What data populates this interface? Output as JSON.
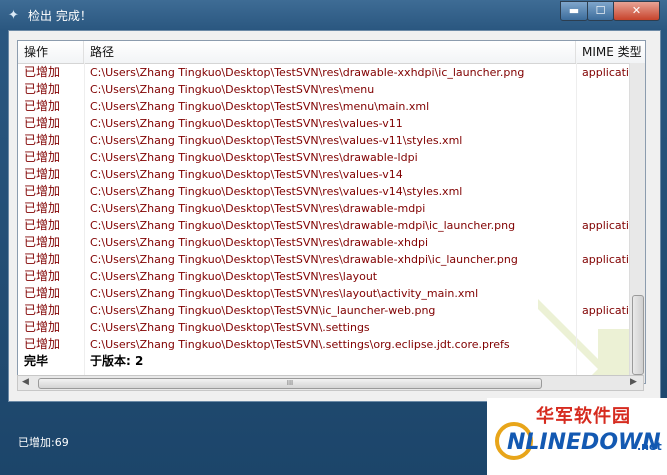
{
  "window": {
    "title": "检出 完成！",
    "minimize_glyph": "▬",
    "maximize_glyph": "☐",
    "close_glyph": "✕"
  },
  "table": {
    "columns": [
      "操作",
      "路径",
      "MIME 类型"
    ],
    "rows": [
      {
        "action": "已增加",
        "path": "C:\\Users\\Zhang Tingkuo\\Desktop\\TestSVN\\res\\drawable-xxhdpi\\ic_launcher.png",
        "mime": "application"
      },
      {
        "action": "已增加",
        "path": "C:\\Users\\Zhang Tingkuo\\Desktop\\TestSVN\\res\\menu",
        "mime": ""
      },
      {
        "action": "已增加",
        "path": "C:\\Users\\Zhang Tingkuo\\Desktop\\TestSVN\\res\\menu\\main.xml",
        "mime": ""
      },
      {
        "action": "已增加",
        "path": "C:\\Users\\Zhang Tingkuo\\Desktop\\TestSVN\\res\\values-v11",
        "mime": ""
      },
      {
        "action": "已增加",
        "path": "C:\\Users\\Zhang Tingkuo\\Desktop\\TestSVN\\res\\values-v11\\styles.xml",
        "mime": ""
      },
      {
        "action": "已增加",
        "path": "C:\\Users\\Zhang Tingkuo\\Desktop\\TestSVN\\res\\drawable-ldpi",
        "mime": ""
      },
      {
        "action": "已增加",
        "path": "C:\\Users\\Zhang Tingkuo\\Desktop\\TestSVN\\res\\values-v14",
        "mime": ""
      },
      {
        "action": "已增加",
        "path": "C:\\Users\\Zhang Tingkuo\\Desktop\\TestSVN\\res\\values-v14\\styles.xml",
        "mime": ""
      },
      {
        "action": "已增加",
        "path": "C:\\Users\\Zhang Tingkuo\\Desktop\\TestSVN\\res\\drawable-mdpi",
        "mime": ""
      },
      {
        "action": "已增加",
        "path": "C:\\Users\\Zhang Tingkuo\\Desktop\\TestSVN\\res\\drawable-mdpi\\ic_launcher.png",
        "mime": "application"
      },
      {
        "action": "已增加",
        "path": "C:\\Users\\Zhang Tingkuo\\Desktop\\TestSVN\\res\\drawable-xhdpi",
        "mime": ""
      },
      {
        "action": "已增加",
        "path": "C:\\Users\\Zhang Tingkuo\\Desktop\\TestSVN\\res\\drawable-xhdpi\\ic_launcher.png",
        "mime": "application"
      },
      {
        "action": "已增加",
        "path": "C:\\Users\\Zhang Tingkuo\\Desktop\\TestSVN\\res\\layout",
        "mime": ""
      },
      {
        "action": "已增加",
        "path": "C:\\Users\\Zhang Tingkuo\\Desktop\\TestSVN\\res\\layout\\activity_main.xml",
        "mime": ""
      },
      {
        "action": "已增加",
        "path": "C:\\Users\\Zhang Tingkuo\\Desktop\\TestSVN\\ic_launcher-web.png",
        "mime": "application"
      },
      {
        "action": "已增加",
        "path": "C:\\Users\\Zhang Tingkuo\\Desktop\\TestSVN\\.settings",
        "mime": ""
      },
      {
        "action": "已增加",
        "path": "C:\\Users\\Zhang Tingkuo\\Desktop\\TestSVN\\.settings\\org.eclipse.jdt.core.prefs",
        "mime": ""
      },
      {
        "action": "完毕",
        "path": "于版本: 2",
        "mime": "",
        "done": true
      }
    ]
  },
  "scrollbar": {
    "left_arrow": "◀",
    "right_arrow": "▶",
    "grip": "III"
  },
  "status": {
    "text": "已增加:69"
  },
  "watermark": {
    "cn": "华军软件园",
    "en": "NLINEDOWN",
    "suffix": ".net"
  },
  "colors": {
    "added_text": "#800000",
    "window_bg": "#1f4a6e"
  }
}
